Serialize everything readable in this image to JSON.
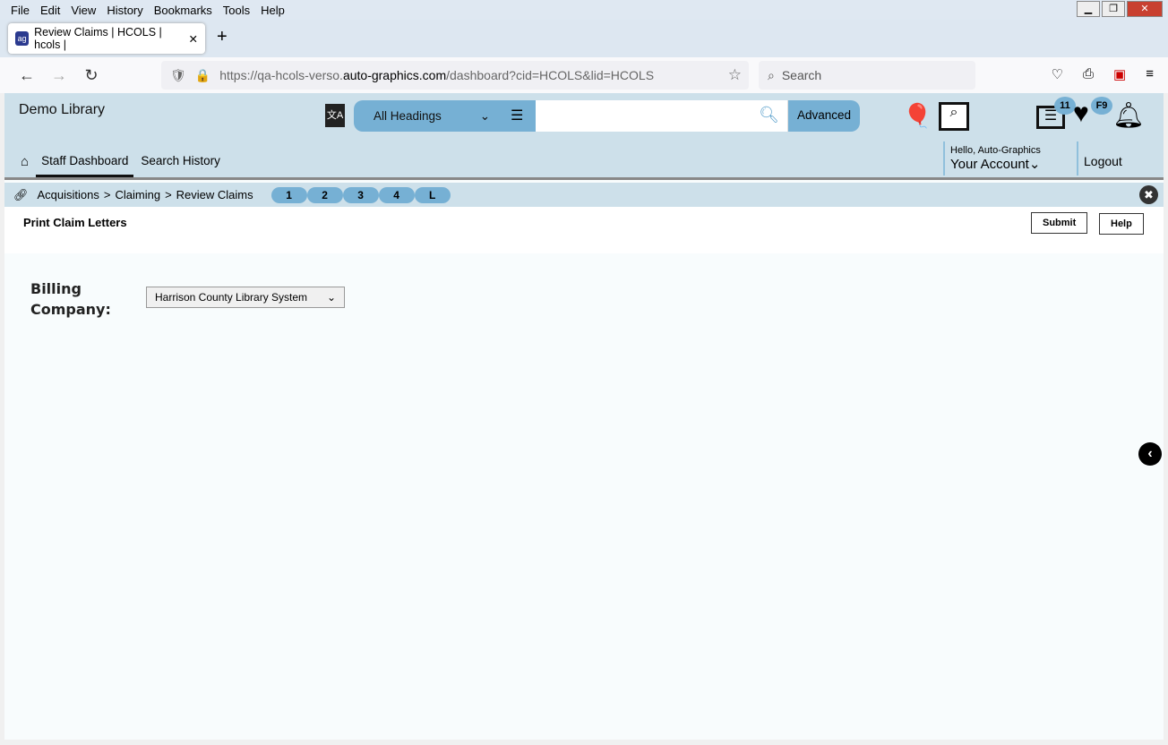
{
  "browser": {
    "menu": [
      "File",
      "Edit",
      "View",
      "History",
      "Bookmarks",
      "Tools",
      "Help"
    ],
    "tab_title": "Review Claims | HCOLS | hcols |",
    "url_prefix": "https://qa-hcols-verso.",
    "url_domain": "auto-graphics.com",
    "url_suffix": "/dashboard?cid=HCOLS&lid=HCOLS",
    "search_placeholder": "Search"
  },
  "header": {
    "library": "Demo Library",
    "heading_select": "All Headings",
    "advanced": "Advanced",
    "list_badge": "11",
    "fav_badge": "F9",
    "nav": [
      "Staff Dashboard",
      "Search History"
    ],
    "greeting": "Hello, Auto-Graphics",
    "account": "Your Account",
    "logout": "Logout"
  },
  "breadcrumb": {
    "items": [
      "Acquisitions",
      "Claiming",
      "Review Claims"
    ],
    "pills": [
      "1",
      "2",
      "3",
      "4",
      "L"
    ]
  },
  "main": {
    "title": "Print Claim Letters",
    "submit": "Submit",
    "help": "Help",
    "billing_label": "Billing Company:",
    "billing_value": "Harrison County Library System"
  }
}
